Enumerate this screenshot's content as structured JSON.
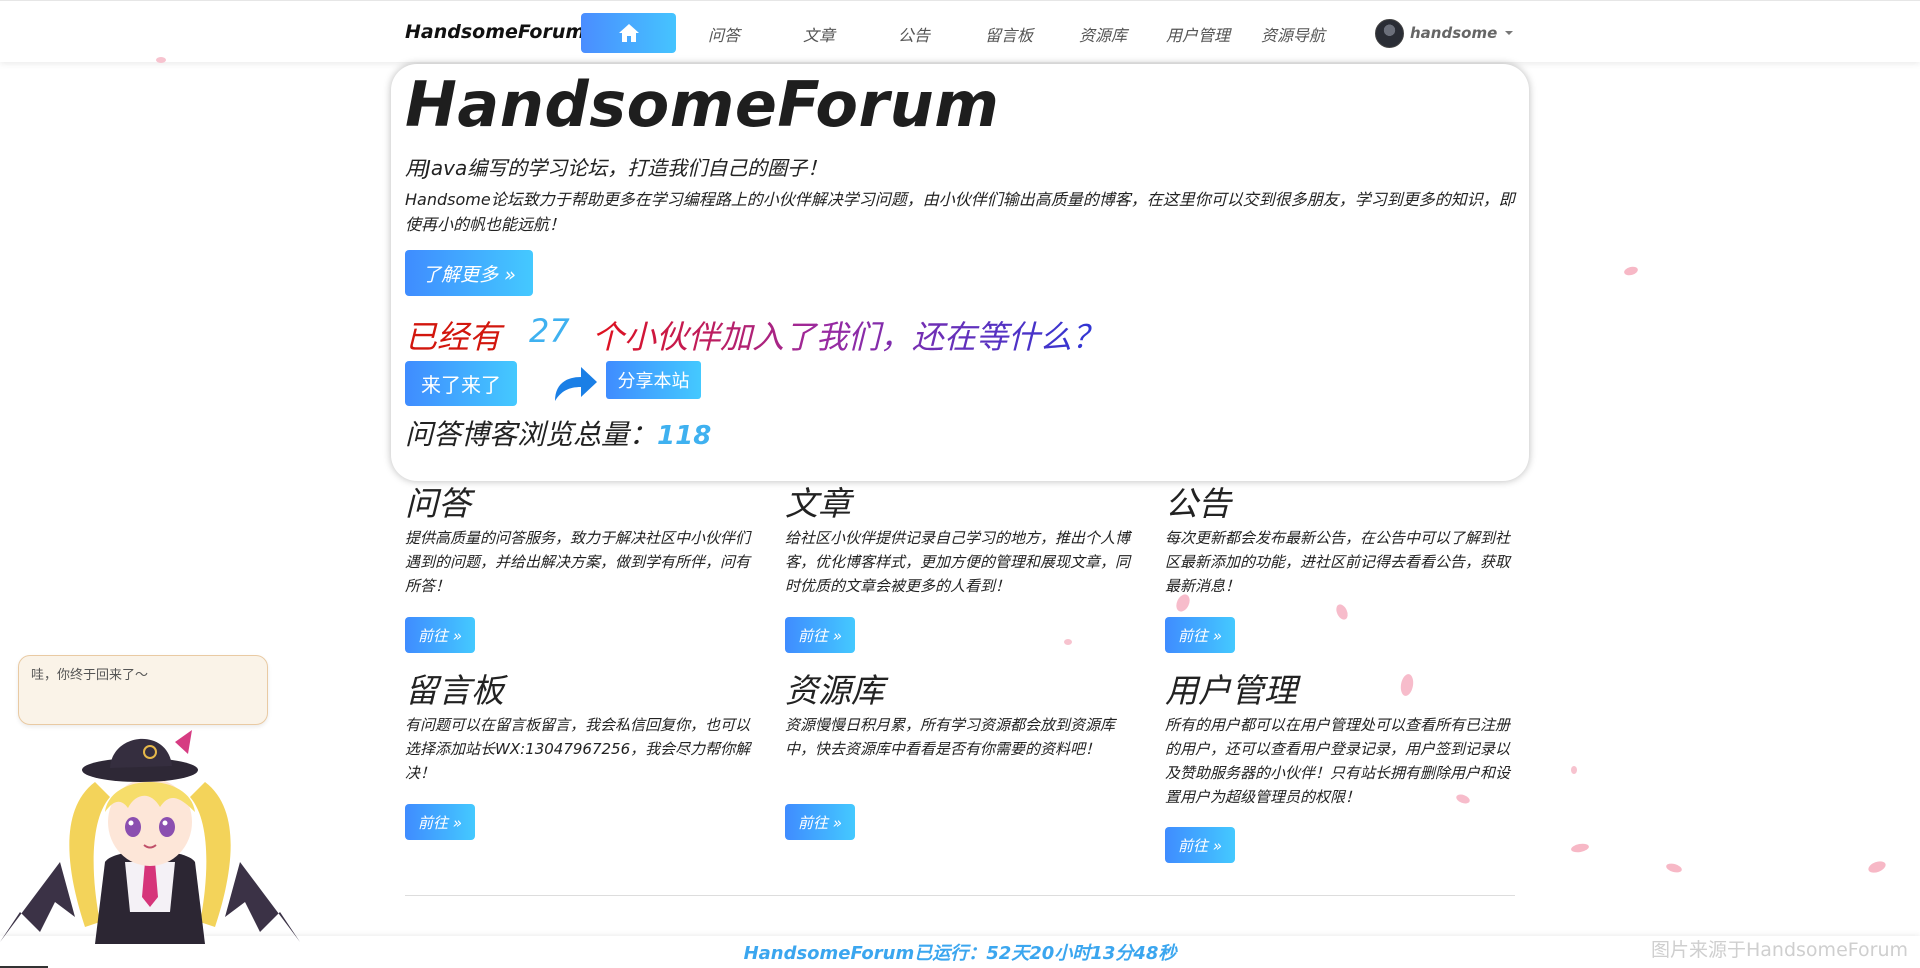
{
  "nav": {
    "brand": "HandsomeForum",
    "home_icon": "home-icon",
    "items": [
      {
        "label": "问答"
      },
      {
        "label": "文章"
      },
      {
        "label": "公告"
      },
      {
        "label": "留言板"
      },
      {
        "label": "资源库"
      },
      {
        "label": "用户管理"
      },
      {
        "label": "资源导航"
      }
    ],
    "user": {
      "name": "handsome",
      "avatar": "avatar-icon",
      "dropdown": "caret-down-icon"
    }
  },
  "hero": {
    "title": "HandsomeForum",
    "subtitle": "用Java编写的学习论坛，打造我们自己的圈子！",
    "description": "Handsome论坛致力于帮助更多在学习编程路上的小伙伴解决学习问题，由小伙伴们输出高质量的博客，在这里你可以交到很多朋友，学习到更多的知识，即使再小的帆也能远航！",
    "more_button": "了解更多 »",
    "join_prefix": "已经有",
    "join_count": "27",
    "join_suffix": "个小伙伴加入了我们，还在等什么？",
    "come_button": "来了来了",
    "share_button": "分享本站",
    "share_icon": "share-arrow-icon",
    "views_label": "问答博客浏览总量：",
    "views_count": "118"
  },
  "features": [
    {
      "title": "问答",
      "text": "提供高质量的问答服务，致力于解决社区中小伙伴们遇到的问题，并给出解决方案，做到学有所伴，问有所答！",
      "button": "前往 »"
    },
    {
      "title": "文章",
      "text": "给社区小伙伴提供记录自己学习的地方，推出个人博客，优化博客样式，更加方便的管理和展现文章，同时优质的文章会被更多的人看到！",
      "button": "前往 »"
    },
    {
      "title": "公告",
      "text": "每次更新都会发布最新公告，在公告中可以了解到社区最新添加的功能，进社区前记得去看看公告，获取最新消息！",
      "button": "前往 »"
    },
    {
      "title": "留言板",
      "text": "有问题可以在留言板留言，我会私信回复你，也可以选择添加站长WX:13047967256，我会尽力帮你解决！",
      "button": "前往 »"
    },
    {
      "title": "资源库",
      "text": "资源慢慢日积月累，所有学习资源都会放到资源库中，快去资源库中看看是否有你需要的资料吧！",
      "button": "前往 »"
    },
    {
      "title": "用户管理",
      "text": "所有的用户都可以在用户管理处可以查看所有已注册的用户，还可以查看用户登录记录，用户签到记录以及赞助服务器的小伙伴！只有站长拥有删除用户和设置用户为超级管理员的权限！",
      "button": "前往 »"
    }
  ],
  "footer": {
    "runtime": "HandsomeForum已运行：52天20小时13分48秒",
    "watermark": "图片来源于HandsomeForum"
  },
  "widget": {
    "message": "哇，你终于回来了～",
    "character": "mascot-girl-icon"
  },
  "colors": {
    "accent_start": "#3f8cff",
    "accent_end": "#44c9ff",
    "count_blue": "#3fb1f0",
    "join_red": "#d2160d",
    "footer_blue": "#3ba6ef"
  }
}
